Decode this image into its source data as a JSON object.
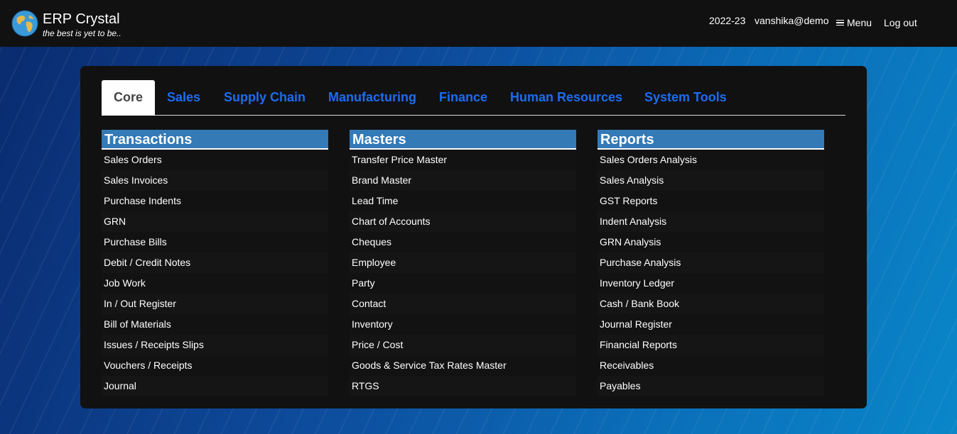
{
  "header": {
    "brand_title": "ERP Crystal",
    "brand_tagline": "the best is yet to be..",
    "fiscal_year": "2022-23",
    "user": "vanshika@demo",
    "menu_label": "Menu",
    "logout_label": "Log out"
  },
  "tabs": [
    "Core",
    "Sales",
    "Supply Chain",
    "Manufacturing",
    "Finance",
    "Human Resources",
    "System Tools"
  ],
  "active_tab": "Core",
  "columns": [
    {
      "title": "Transactions",
      "items": [
        "Sales Orders",
        "Sales Invoices",
        "Purchase Indents",
        "GRN",
        "Purchase Bills",
        "Debit / Credit Notes",
        "Job Work",
        "In / Out Register",
        "Bill of Materials",
        "Issues / Receipts Slips",
        "Vouchers / Receipts",
        "Journal"
      ]
    },
    {
      "title": "Masters",
      "items": [
        "Transfer Price Master",
        "Brand Master",
        "Lead Time",
        "Chart of Accounts",
        "Cheques",
        "Employee",
        "Party",
        "Contact",
        "Inventory",
        "Price / Cost",
        "Goods & Service Tax Rates Master",
        "RTGS"
      ]
    },
    {
      "title": "Reports",
      "items": [
        "Sales Orders Analysis",
        "Sales Analysis",
        "GST Reports",
        "Indent Analysis",
        "GRN Analysis",
        "Purchase Analysis",
        "Inventory Ledger",
        "Cash / Bank Book",
        "Journal Register",
        "Financial Reports",
        "Receivables",
        "Payables"
      ]
    }
  ],
  "colors": {
    "accent_tab": "#1d6cf0",
    "column_header": "#337ab7",
    "topbar": "#111111"
  },
  "icons": {
    "logo": "globe-icon",
    "menu": "hamburger-icon"
  }
}
